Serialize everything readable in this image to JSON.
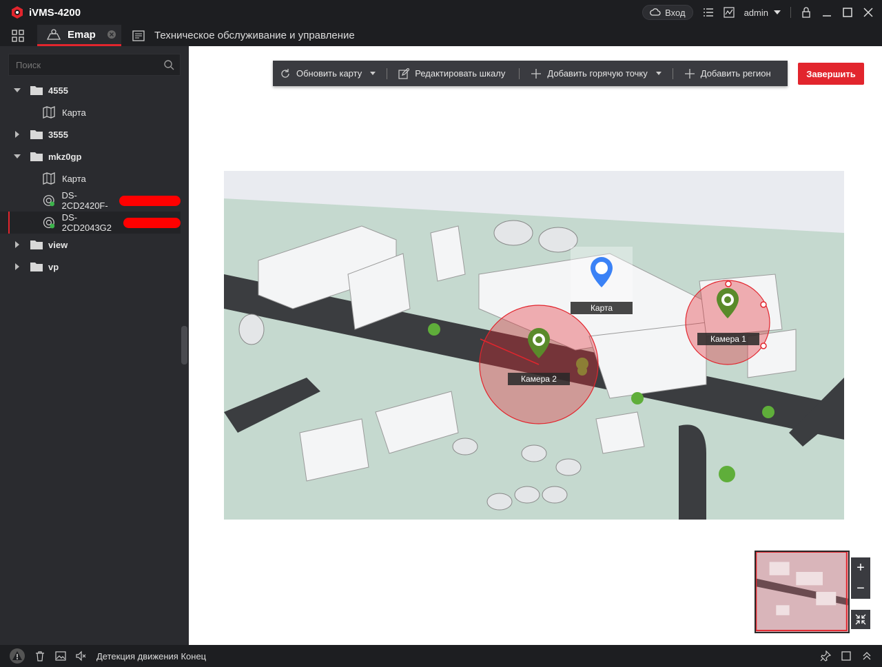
{
  "app": {
    "title": "iVMS-4200",
    "brand_color": "#e2252d"
  },
  "header": {
    "login_label": "Вход",
    "user": "admin"
  },
  "tabs": [
    {
      "label": "Emap",
      "active": true
    },
    {
      "label": "Техническое обслуживание и управление",
      "active": false
    }
  ],
  "sidebar": {
    "search_placeholder": "Поиск",
    "tree": [
      {
        "label": "4555",
        "type": "folder",
        "expanded": true
      },
      {
        "label": "Карта",
        "type": "map"
      },
      {
        "label": "3555",
        "type": "folder",
        "expanded": false
      },
      {
        "label": "mkz0gp",
        "type": "folder",
        "expanded": true
      },
      {
        "label": "Карта",
        "type": "map"
      },
      {
        "label": "DS-2CD2420F-",
        "type": "camera"
      },
      {
        "label": "DS-2CD2043G2",
        "type": "camera",
        "selected": true
      },
      {
        "label": "view",
        "type": "folder",
        "expanded": false
      },
      {
        "label": "vp",
        "type": "folder",
        "expanded": false
      }
    ]
  },
  "toolbar": {
    "refresh_map": "Обновить карту",
    "edit_scale": "Редактировать шкалу",
    "add_hotspot": "Добавить горячую точку",
    "add_region": "Добавить регион",
    "finish": "Завершить"
  },
  "map": {
    "hotspots": [
      {
        "label": "Карта",
        "icon": "map-link-pin-icon",
        "color": "#3b82f6"
      },
      {
        "label": "Камера 1",
        "icon": "camera-pin-icon",
        "color": "#5a8a2a"
      },
      {
        "label": "Камера 2",
        "icon": "camera-pin-icon",
        "color": "#5a8a2a"
      }
    ]
  },
  "status": {
    "message": "Детекция движения Конец"
  }
}
